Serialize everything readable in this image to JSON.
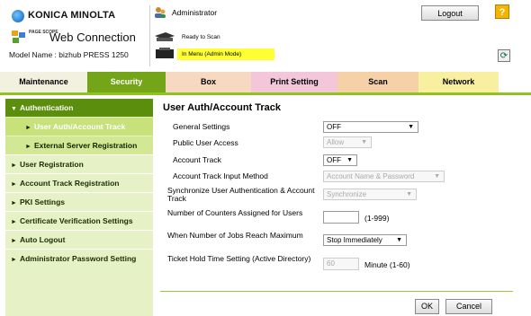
{
  "header": {
    "brand": "KONICA MINOLTA",
    "pagescope": "PAGE SCOPE",
    "product": "Web Connection",
    "model_label": "Model Name : bizhub PRESS 1250",
    "user": "Administrator",
    "logout_label": "Logout",
    "help_label": "?",
    "status_ready": "Ready to Scan",
    "status_menu": "In Menu (Admin Mode)"
  },
  "tabs": [
    {
      "label": "Maintenance",
      "color": "#f2f0df",
      "text": "#000"
    },
    {
      "label": "Security",
      "color": "#74a417",
      "text": "#ffffff"
    },
    {
      "label": "Box",
      "color": "#f7d9c1",
      "text": "#000"
    },
    {
      "label": "Print Setting",
      "color": "#f3c7d9",
      "text": "#000"
    },
    {
      "label": "Scan",
      "color": "#f6d0a6",
      "text": "#000"
    },
    {
      "label": "Network",
      "color": "#f8f0a0",
      "text": "#000"
    }
  ],
  "sidebar": {
    "items": [
      {
        "label": "Authentication"
      },
      {
        "label": "User Auth/Account Track"
      },
      {
        "label": "External Server Registration"
      },
      {
        "label": "User Registration"
      },
      {
        "label": "Account Track Registration"
      },
      {
        "label": "PKI Settings"
      },
      {
        "label": "Certificate Verification Settings"
      },
      {
        "label": "Auto Logout"
      },
      {
        "label": "Administrator Password Setting"
      }
    ]
  },
  "main": {
    "title": "User Auth/Account Track",
    "rows": [
      {
        "label": "General Settings",
        "value": "OFF"
      },
      {
        "label": "Public User Access",
        "value": "Allow"
      },
      {
        "label": "Account Track",
        "value": "OFF"
      },
      {
        "label": "Account Track Input Method",
        "value": "Account Name & Password"
      },
      {
        "label": "Synchronize User Authentication & Account Track",
        "value": "Synchronize"
      },
      {
        "label": "Number of Counters Assigned for Users",
        "value": "",
        "note": "(1-999)"
      },
      {
        "label": "When Number of Jobs Reach Maximum",
        "value": "Stop Immediately"
      },
      {
        "label": "Ticket Hold Time Setting (Active Directory)",
        "value": "60",
        "note": "Minute (1-60)"
      }
    ],
    "ok_label": "OK",
    "cancel_label": "Cancel"
  },
  "colors": {
    "accent": "#8fc31f",
    "sidebar_bg": "#e6f2c6",
    "selected": "#5c8e0e",
    "status_highlight": "#ffff33"
  }
}
